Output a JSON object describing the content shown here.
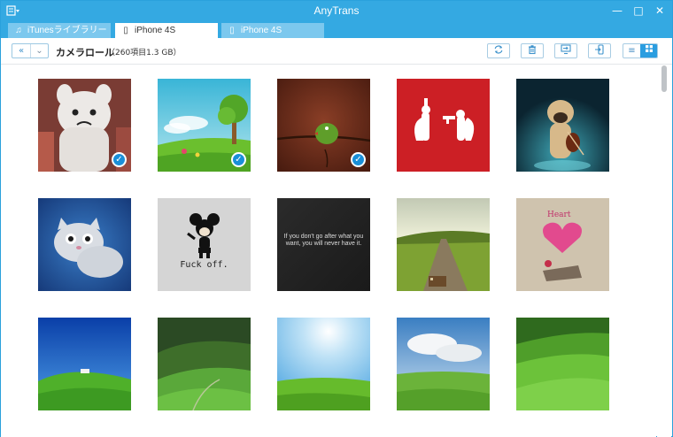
{
  "app": {
    "title": "AnyTrans",
    "menu_icon": "menu-icon"
  },
  "window_controls": {
    "minimize": "—",
    "maximize": "□",
    "close": "✕"
  },
  "tabs": [
    {
      "label": "iTunesライブラリー",
      "icon": "music-note-icon",
      "glyph": "♫",
      "active": false
    },
    {
      "label": "iPhone 4S",
      "icon": "iphone-icon",
      "glyph": "▯",
      "active": true
    },
    {
      "label": "iPhone 4S",
      "icon": "iphone-icon",
      "glyph": "▯",
      "active": false
    }
  ],
  "toolbar": {
    "back_glyph": "«",
    "dropdown_glyph": "⌄",
    "title": "カメラロール",
    "count": "（260項目1.3 GB）",
    "refresh_glyph": "⟳",
    "delete_glyph": "🗑",
    "to_pc_glyph": "⇥",
    "to_device_glyph": "⇤",
    "list_view_glyph": "≡",
    "grid_view_glyph": "▦"
  },
  "photos": [
    {
      "name": "photo-white-cat-doll",
      "selected": true
    },
    {
      "name": "photo-cartoon-meadow",
      "selected": true
    },
    {
      "name": "photo-green-bird",
      "selected": true
    },
    {
      "name": "photo-red-squirrels",
      "selected": false
    },
    {
      "name": "photo-pug-violin",
      "selected": false
    },
    {
      "name": "photo-knit-cat",
      "selected": false
    },
    {
      "name": "photo-mickey",
      "selected": false,
      "caption": "Fuck off."
    },
    {
      "name": "photo-quote",
      "selected": false,
      "caption": "If you don't go after what you want, you will never have it."
    },
    {
      "name": "photo-road-suitcase",
      "selected": false
    },
    {
      "name": "photo-heart",
      "selected": false,
      "caption": "Heart"
    },
    {
      "name": "photo-green-hill",
      "selected": false
    },
    {
      "name": "photo-green-valley",
      "selected": false
    },
    {
      "name": "photo-sunny-field",
      "selected": false
    },
    {
      "name": "photo-cloudy-field",
      "selected": false
    },
    {
      "name": "photo-green-slope",
      "selected": false
    }
  ],
  "colors": {
    "accent": "#34a9e2",
    "selected_check": "#1a8fd8"
  }
}
